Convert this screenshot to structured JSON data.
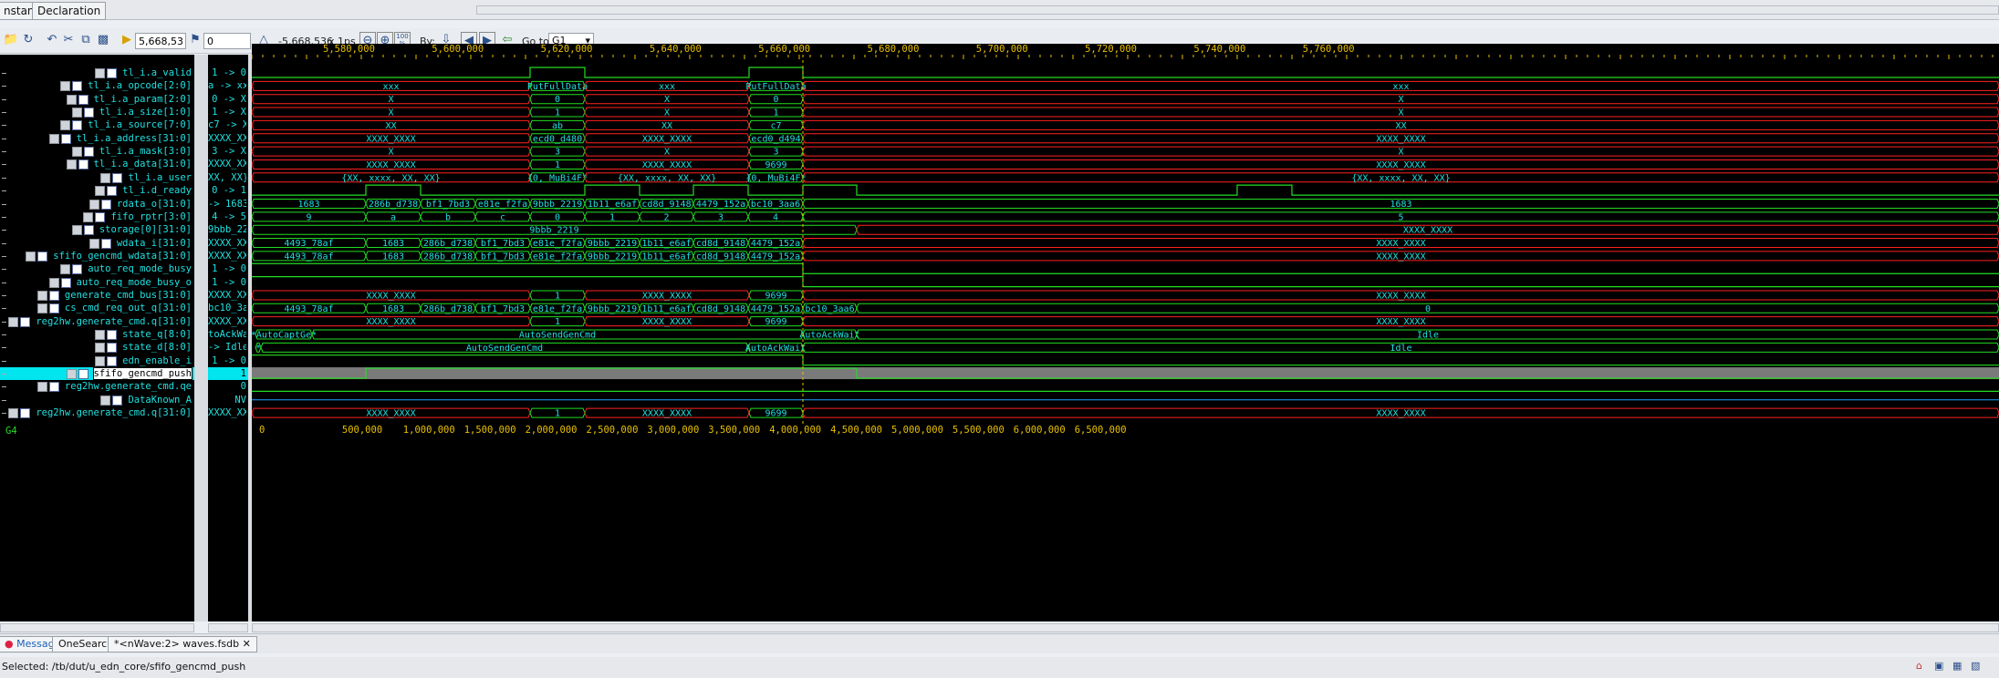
{
  "tabs": {
    "instance": "nstance",
    "declaration": "Declaration"
  },
  "toolbar": {
    "cursor_time": "5,668,536",
    "marker_time": "0",
    "delta_time": "-5,668,536",
    "time_unit": "x 1ps",
    "zoom_pct": "100\n%",
    "by_label": "By:",
    "goto_label": "Go to:",
    "goto_value": "G1"
  },
  "signals": [
    {
      "name": "tl_i.a_valid",
      "value": "1 -> 0"
    },
    {
      "name": "tl_i.a_opcode[2:0]",
      "value": "a -> xxx"
    },
    {
      "name": "tl_i.a_param[2:0]",
      "value": "0 -> X"
    },
    {
      "name": "tl_i.a_size[1:0]",
      "value": "1 -> X"
    },
    {
      "name": "tl_i.a_source[7:0]",
      "value": "c7 -> XX"
    },
    {
      "name": "tl_i.a_address[31:0]",
      "value": "XXXX_XXXX"
    },
    {
      "name": "tl_i.a_mask[3:0]",
      "value": "3 -> X"
    },
    {
      "name": "tl_i.a_data[31:0]",
      "value": "XXXX_XXXX"
    },
    {
      "name": "tl_i.a_user",
      "value": "XX, XX}"
    },
    {
      "name": "tl_i.d_ready",
      "value": "0 -> 1"
    },
    {
      "name": "rdata_o[31:0]",
      "value": "-> 1683"
    },
    {
      "name": "fifo_rptr[3:0]",
      "value": "4 -> 5"
    },
    {
      "name": "storage[0][31:0]",
      "value": "9bbb_2219"
    },
    {
      "name": "wdata_i[31:0]",
      "value": "XXXX_XXXX"
    },
    {
      "name": "sfifo_gencmd_wdata[31:0]",
      "value": "XXXX_XXXX"
    },
    {
      "name": "auto_req_mode_busy",
      "value": "1 -> 0"
    },
    {
      "name": "auto_req_mode_busy_o",
      "value": "1 -> 0"
    },
    {
      "name": "generate_cmd_bus[31:0]",
      "value": "XXXX_XXXX"
    },
    {
      "name": "cs_cmd_req_out_q[31:0]",
      "value": "bc10_3aa6"
    },
    {
      "name": "reg2hw.generate_cmd.q[31:0]",
      "value": "XXXX_XXXX"
    },
    {
      "name": "state_q[8:0]",
      "value": "toAckWait"
    },
    {
      "name": "state_d[8:0]",
      "value": "-> Idle"
    },
    {
      "name": "edn_enable_i",
      "value": "1 -> 0"
    },
    {
      "name": "sfifo_gencmd_push",
      "value": "1"
    },
    {
      "name": "reg2hw.generate_cmd.qe",
      "value": "0"
    },
    {
      "name": "DataKnown_A",
      "value": "NV"
    },
    {
      "name": "reg2hw.generate_cmd.q[31:0]",
      "value": "XXXX_XXXX"
    }
  ],
  "group_label": "G4",
  "ruler_top": [
    "5,580,000",
    "5,600,000",
    "5,620,000",
    "5,640,000",
    "5,660,000",
    "5,680,000",
    "5,700,000",
    "5,720,000",
    "5,740,000",
    "5,760,000"
  ],
  "ruler_bottom": [
    "0",
    "500,000",
    "1,000,000",
    "1,500,000",
    "2,000,000",
    "2,500,000",
    "3,000,000",
    "3,500,000",
    "4,000,000",
    "4,500,000",
    "5,000,000",
    "5,500,000",
    "6,000,000",
    "6,500,000"
  ],
  "bottom_tabs": {
    "message": "Message",
    "onesearch": "OneSearch",
    "nwave": "*<nWave:2> waves.fsdb"
  },
  "status": "Selected: /tb/dut/u_edn_core/sfifo_gencmd_push",
  "waves": {
    "a_opcode": [
      "xxx",
      "PutFullData",
      "xxx",
      "PutFullData",
      "xxx"
    ],
    "a_param": [
      "X",
      "0",
      "X",
      "0",
      "X"
    ],
    "a_size": [
      "X",
      "1",
      "X",
      "1",
      "X"
    ],
    "a_source": [
      "XX",
      "ab",
      "XX",
      "c7",
      "XX"
    ],
    "a_address": [
      "XXXX_XXXX",
      "ecd0_d480",
      "XXXX_XXXX",
      "ecd0_d494",
      "XXXX_XXXX"
    ],
    "a_mask": [
      "X",
      "3",
      "X",
      "3",
      "X"
    ],
    "a_data": [
      "XXXX_XXXX",
      "1",
      "XXXX_XXXX",
      "9699",
      "XXXX_XXXX"
    ],
    "a_user": [
      "{XX, xxxx, XX, XX}",
      "{0, MuBi4F*",
      "{XX, xxxx, XX, XX}",
      "{0, MuBi4F*",
      "{XX, xxxx, XX, XX}"
    ],
    "rdata": [
      "1683",
      "286b_d738",
      "bf1_7bd3",
      "e81e_f2fa",
      "9bbb_2219",
      "1b11_e6af",
      "cd8d_9148",
      "4479_152a",
      "bc10_3aa6",
      "1683"
    ],
    "fifo_rptr": [
      "9",
      "a",
      "b",
      "c",
      "0",
      "1",
      "2",
      "3",
      "4",
      "5"
    ],
    "storage": [
      "9bbb_2219",
      "XXXX_XXXX"
    ],
    "wdata": [
      "4493_78af",
      "1683",
      "286b_d738",
      "bf1_7bd3",
      "e81e_f2fa",
      "9bbb_2219",
      "1b11_e6af",
      "cd8d_9148",
      "4479_152a",
      "XXXX_XXXX"
    ],
    "gencmd_wdata": [
      "4493_78af",
      "1683",
      "286b_d738",
      "bf1_7bd3",
      "e81e_f2fa",
      "9bbb_2219",
      "1b11_e6af",
      "cd8d_9148",
      "4479_152a",
      "XXXX_XXXX"
    ],
    "gen_cmd_bus": [
      "XXXX_XXXX",
      "1",
      "XXXX_XXXX",
      "9699",
      "XXXX_XXXX"
    ],
    "cs_cmd": [
      "4493_78af",
      "1683",
      "286b_d738",
      "bf1_7bd3",
      "e81e_f2fa",
      "9bbb_2219",
      "1b11_e6af",
      "cd8d_9148",
      "4479_152a",
      "bc10_3aa6",
      "0"
    ],
    "reg2hw_q": [
      "XXXX_XXXX",
      "1",
      "XXXX_XXXX",
      "9699",
      "XXXX_XXXX"
    ],
    "state_q": [
      "*AutoCaptGe*",
      "AutoSendGenCmd",
      "AutoAckWait",
      "Idle"
    ],
    "state_d": [
      "*",
      "AutoSendGenCmd",
      "AutoAckWait",
      "Idle"
    ],
    "reg2hw_q2": [
      "XXXX_XXXX",
      "1",
      "XXXX_XXXX",
      "9699",
      "XXXX_XXXX"
    ]
  },
  "colors": {
    "wave": "#22dd22",
    "bus_text": "#20e0e0",
    "x_line": "#ff2020",
    "cursor": "#e8c000",
    "highlight": "#00e5ee",
    "ruler": "#e8c000"
  }
}
